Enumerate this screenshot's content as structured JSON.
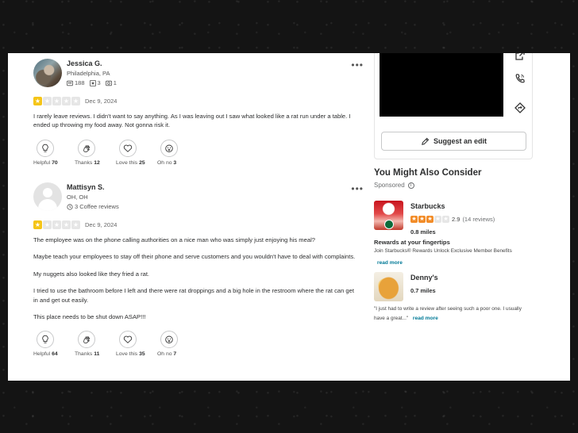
{
  "reviews": [
    {
      "name": "Jessica G.",
      "location": "Philadelphia, PA",
      "stats": {
        "friends": "188",
        "reviews": "3",
        "photos": "1"
      },
      "stars": 1,
      "date": "Dec 9, 2024",
      "paragraphs": [
        "I rarely leave reviews. I didn't want to say anything. As I was leaving out I saw what looked like a rat run under a table. I ended up throwing my food away. Not gonna risk it."
      ],
      "reactions": [
        {
          "label": "Helpful",
          "count": "70",
          "icon": "lightbulb-icon"
        },
        {
          "label": "Thanks",
          "count": "12",
          "icon": "clap-icon"
        },
        {
          "label": "Love this",
          "count": "25",
          "icon": "heart-icon"
        },
        {
          "label": "Oh no",
          "count": "3",
          "icon": "oh-no-icon"
        }
      ]
    },
    {
      "name": "Mattisyn S.",
      "location": "OH, OH",
      "review_count_text": "3 Coffee reviews",
      "stars": 1,
      "date": "Dec 9, 2024",
      "paragraphs": [
        "The employee was on the phone calling authorities on a nice man who was simply just enjoying his meal?",
        "Maybe teach your employees to stay off their phone and serve customers and you wouldn't have to deal with complaints.",
        "My nuggets also looked like they fried a rat.",
        "I tried to use the bathroom before I left and there were rat droppings and a big hole in the restroom where the rat can get in and get out easily.",
        "This place needs to be shut down ASAP!!!"
      ],
      "reactions": [
        {
          "label": "Helpful",
          "count": "64",
          "icon": "lightbulb-icon"
        },
        {
          "label": "Thanks",
          "count": "11",
          "icon": "clap-icon"
        },
        {
          "label": "Love this",
          "count": "35",
          "icon": "heart-icon"
        },
        {
          "label": "Oh no",
          "count": "7",
          "icon": "oh-no-icon"
        }
      ]
    }
  ],
  "sidebar": {
    "side_icons": [
      "external-link-icon",
      "phone-icon",
      "directions-icon"
    ],
    "suggest_edit": "Suggest an edit",
    "consider_title": "You Might Also Consider",
    "sponsored": "Sponsored",
    "businesses": [
      {
        "name": "Starbucks",
        "rating": "2.9",
        "stars": 3,
        "review_count": "(14 reviews)",
        "distance": "0.8 miles",
        "promo_title": "Rewards at your fingertips",
        "promo_text": "Join Starbucks® Rewards Unlock Exclusive Member Benefits",
        "read_more": "read more"
      },
      {
        "name": "Denny's",
        "distance": "0.7 miles",
        "quote": "\"I just had to write a review after seeing such a poor one. I usually have a great...\"",
        "read_more": "read more"
      }
    ]
  },
  "colors": {
    "star_on": "#f5c518",
    "star_off": "#e6e6e6",
    "biz_star": "#f28c28",
    "link": "#027a97",
    "backdrop": "#141414"
  }
}
